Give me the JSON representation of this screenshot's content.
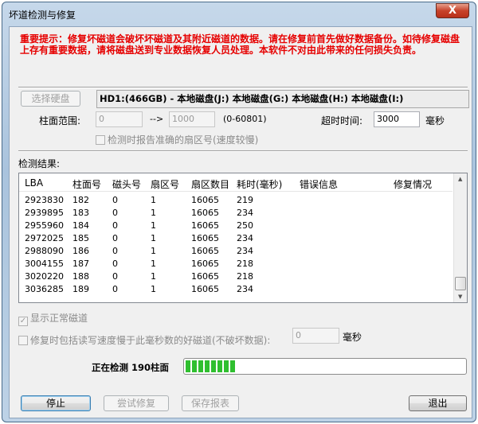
{
  "window": {
    "title": "坏道检测与修复",
    "close_label": "X"
  },
  "warning": "重要提示：修复坏磁道会破坏坏磁道及其附近磁道的数据。请在修复前首先做好数据备份。如待修复磁盘上存有重要数据，请将磁盘送到专业数据恢复人员处理。本软件不对由此带来的任何损失负责。",
  "disk": {
    "select_label": "选择硬盘",
    "info": "HD1:(466GB) - 本地磁盘(J:) 本地磁盘(G:) 本地磁盘(H:) 本地磁盘(I:)"
  },
  "range": {
    "label": "柱面范围:",
    "from": "0",
    "arrow": "-->",
    "to": "1000",
    "hint": "(0-60801)"
  },
  "timeout": {
    "label": "超时时间:",
    "value": "3000",
    "unit": "毫秒"
  },
  "accurate_sector": {
    "label": "检测时报告准确的扇区号(速度较慢)",
    "checked": false
  },
  "results": {
    "label": "检测结果:",
    "columns": [
      "LBA",
      "柱面号",
      "磁头号",
      "扇区号",
      "扇区数目",
      "耗时(毫秒)",
      "错误信息",
      "修复情况"
    ],
    "rows": [
      [
        "2923830",
        "182",
        "0",
        "1",
        "16065",
        "219",
        "",
        ""
      ],
      [
        "2939895",
        "183",
        "0",
        "1",
        "16065",
        "234",
        "",
        ""
      ],
      [
        "2955960",
        "184",
        "0",
        "1",
        "16065",
        "250",
        "",
        ""
      ],
      [
        "2972025",
        "185",
        "0",
        "1",
        "16065",
        "234",
        "",
        ""
      ],
      [
        "2988090",
        "186",
        "0",
        "1",
        "16065",
        "234",
        "",
        ""
      ],
      [
        "3004155",
        "187",
        "0",
        "1",
        "16065",
        "218",
        "",
        ""
      ],
      [
        "3020220",
        "188",
        "0",
        "1",
        "16065",
        "218",
        "",
        ""
      ],
      [
        "3036285",
        "189",
        "0",
        "1",
        "16065",
        "234",
        "",
        ""
      ]
    ]
  },
  "show_normal": {
    "label": "显示正常磁道",
    "checked": true
  },
  "include_slow": {
    "label": "修复时包括读写速度慢于此毫秒数的好磁道(不破坏数据):",
    "value": "0",
    "unit": "毫秒",
    "checked": false
  },
  "progress": {
    "status": "正在检测 190柱面",
    "fraction": 0.18,
    "color": "#2fbf2f"
  },
  "buttons": {
    "stop": "停止",
    "try_repair": "尝试修复",
    "save_report": "保存报表",
    "exit": "退出"
  }
}
